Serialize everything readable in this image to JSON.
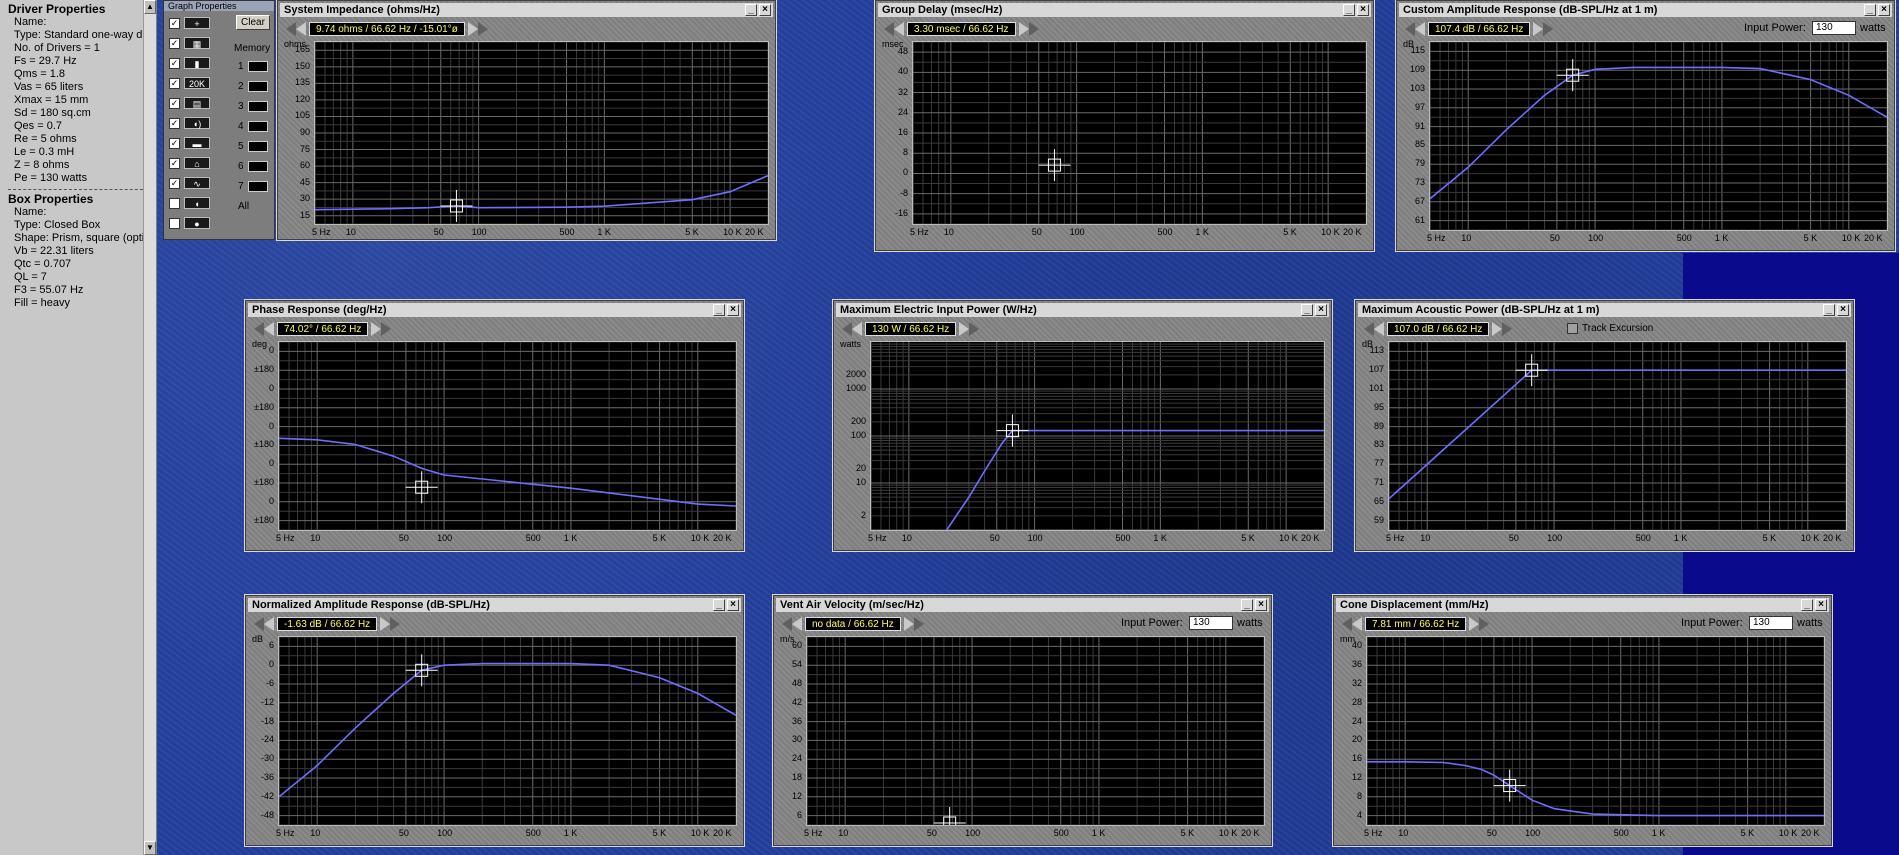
{
  "driver_properties": {
    "heading": "Driver Properties",
    "rows": [
      "Name:",
      "Type: Standard one-way driv",
      "No. of Drivers = 1",
      "Fs = 29.7 Hz",
      "Qms = 1.8",
      "Vas = 65 liters",
      "Xmax = 15 mm",
      "Sd = 180 sq.cm",
      "Qes = 0.7",
      "Re = 5 ohms",
      "Le = 0.3 mH",
      "Z = 8 ohms",
      "Pe = 130 watts"
    ]
  },
  "box_properties": {
    "heading": "Box Properties",
    "rows": [
      "Name:",
      "Type: Closed Box",
      "Shape: Prism, square (optimu",
      "Vb = 22.31 liters",
      "Qtc = 0.707",
      "QL = 7",
      "F3 = 55.07 Hz",
      "Fill = heavy"
    ]
  },
  "graph_properties": {
    "title": "Graph Properties",
    "clear_label": "Clear",
    "memory_label": "Memory",
    "memory_slots": [
      "1",
      "2",
      "3",
      "4",
      "5",
      "6",
      "7"
    ],
    "all_label": "All",
    "icons": [
      "crosshair-icon",
      "grid-icon",
      "marker-icon",
      "range-20k-icon",
      "print-icon",
      "speaker-sound-icon",
      "speaker-box-icon",
      "house-icon",
      "waveform-icon",
      "speaker-small-icon",
      "record-icon"
    ]
  },
  "x_ticks": [
    "5 Hz",
    "10",
    "50",
    "100",
    "500",
    "1 K",
    "5 K",
    "10 K",
    "20 K"
  ],
  "input_power_label": "Input Power:",
  "input_power_value": "130",
  "input_power_unit": "watts",
  "track_excursion_label": "Track Excursion",
  "colors": {
    "curve": "#6f6fff",
    "readout_text": "#ffff66",
    "background": "#223f9e",
    "plot_bg": "#000000"
  },
  "graphs": [
    {
      "id": "impedance",
      "title": "System Impedance (ohms/Hz)",
      "readout": "9.74 ohms / 66.62 Hz / -15.01°ø",
      "yunit": "ohms",
      "yticks": [
        "165",
        "150",
        "135",
        "120",
        "105",
        "90",
        "75",
        "60",
        "45",
        "30",
        "15"
      ],
      "chart_data": {
        "type": "line",
        "xlabel": "",
        "ylabel": "ohms",
        "xscale": "log",
        "xlim": [
          5,
          20000
        ],
        "ylim": [
          0,
          165
        ],
        "cursor": [
          66.62,
          9.74
        ],
        "x": [
          5,
          20,
          40,
          66.62,
          100,
          500,
          1000,
          5000,
          10000,
          20000
        ],
        "y": [
          6,
          7,
          8,
          9.74,
          8,
          8.5,
          9.5,
          16,
          24,
          40
        ]
      }
    },
    {
      "id": "group-delay",
      "title": "Group Delay (msec/Hz)",
      "readout": "3.30 msec / 66.62 Hz",
      "yunit": "msec",
      "yticks": [
        "48",
        "40",
        "32",
        "24",
        "16",
        "8",
        "0",
        "-8",
        "-16"
      ],
      "chart_data": {
        "type": "line",
        "xlabel": "",
        "ylabel": "msec",
        "xscale": "log",
        "xlim": [
          5,
          20000
        ],
        "ylim": [
          -16,
          48
        ],
        "cursor": [
          66.62,
          3.3
        ],
        "x": [],
        "y": []
      }
    },
    {
      "id": "custom-amplitude",
      "title": "Custom Amplitude Response (dB-SPL/Hz at 1 m)",
      "readout": "107.4 dB / 66.62 Hz",
      "yunit": "dB",
      "yticks": [
        "115",
        "109",
        "103",
        "97",
        "91",
        "85",
        "79",
        "73",
        "67",
        "61"
      ],
      "chart_data": {
        "type": "line",
        "xlabel": "",
        "ylabel": "dB",
        "xscale": "log",
        "xlim": [
          5,
          20000
        ],
        "ylim": [
          61,
          115
        ],
        "cursor": [
          66.62,
          107.4
        ],
        "x": [
          5,
          10,
          20,
          40,
          66.62,
          100,
          200,
          1000,
          2000,
          5000,
          10000,
          20000
        ],
        "y": [
          68,
          78,
          90,
          101,
          107.4,
          109.3,
          109.9,
          109.9,
          109.5,
          106,
          101,
          94
        ]
      }
    },
    {
      "id": "phase",
      "title": "Phase Response (deg/Hz)",
      "readout": "74.02° / 66.62 Hz",
      "yunit": "deg",
      "yticks": [
        "0",
        "±180",
        "0",
        "±180",
        "0",
        "±180",
        "0",
        "±180",
        "0",
        "±180"
      ],
      "chart_data": {
        "type": "line",
        "xlabel": "",
        "ylabel": "deg",
        "xscale": "log",
        "xlim": [
          5,
          20000
        ],
        "cursor": [
          66.62,
          74.02
        ],
        "x": [
          5,
          10,
          20,
          40,
          66.62,
          100,
          1000,
          10000,
          20000
        ],
        "y": [
          178,
          175,
          165,
          140,
          114,
          100,
          72,
          38,
          34
        ]
      }
    },
    {
      "id": "max-electric-power",
      "title": "Maximum Electric Input Power (W/Hz)",
      "readout": "130 W / 66.62 Hz",
      "yunit": "watts",
      "yticks": [
        "2000",
        "1000",
        "200",
        "100",
        "20",
        "10",
        "2"
      ],
      "chart_data": {
        "type": "line",
        "xlabel": "",
        "ylabel": "watts",
        "xscale": "log",
        "yscale": "log",
        "xlim": [
          5,
          20000
        ],
        "ylim": [
          1,
          10000
        ],
        "cursor": [
          66.62,
          130
        ],
        "x": [
          20,
          30,
          40,
          55,
          66.62,
          20000
        ],
        "y": [
          1,
          5,
          18,
          70,
          130,
          130
        ]
      }
    },
    {
      "id": "max-acoustic-power",
      "title": "Maximum Acoustic Power (dB-SPL/Hz at 1 m)",
      "readout": "107.0 dB / 66.62 Hz",
      "yunit": "dB",
      "yticks": [
        "113",
        "107",
        "101",
        "95",
        "89",
        "83",
        "77",
        "71",
        "65",
        "59"
      ],
      "chart_data": {
        "type": "line",
        "xlabel": "",
        "ylabel": "dB",
        "xscale": "log",
        "xlim": [
          5,
          20000
        ],
        "ylim": [
          59,
          113
        ],
        "cursor": [
          66.62,
          107.0
        ],
        "x": [
          5,
          66.62,
          20000
        ],
        "y": [
          66,
          107,
          107
        ]
      }
    },
    {
      "id": "normalized-amplitude",
      "title": "Normalized Amplitude Response (dB-SPL/Hz)",
      "readout": "-1.63 dB / 66.62 Hz",
      "yunit": "dB",
      "yticks": [
        "6",
        "0",
        "-6",
        "-12",
        "-18",
        "-24",
        "-30",
        "-36",
        "-42",
        "-48"
      ],
      "chart_data": {
        "type": "line",
        "xlabel": "",
        "ylabel": "dB",
        "xscale": "log",
        "xlim": [
          5,
          20000
        ],
        "ylim": [
          -48,
          6
        ],
        "cursor": [
          66.62,
          -1.63
        ],
        "x": [
          5,
          10,
          20,
          40,
          66.62,
          100,
          200,
          1000,
          2000,
          5000,
          10000,
          20000
        ],
        "y": [
          -42,
          -32,
          -20,
          -9,
          -1.63,
          0,
          0.5,
          0.5,
          0,
          -4,
          -9,
          -16
        ]
      }
    },
    {
      "id": "vent-air-velocity",
      "title": "Vent Air Velocity (m/sec/Hz)",
      "readout": "no data / 66.62 Hz",
      "yunit": "m/s",
      "yticks": [
        "60",
        "54",
        "48",
        "42",
        "36",
        "30",
        "24",
        "18",
        "12",
        "6"
      ],
      "chart_data": {
        "type": "line",
        "xlabel": "",
        "ylabel": "m/s",
        "xscale": "log",
        "xlim": [
          5,
          20000
        ],
        "ylim": [
          0,
          60
        ],
        "cursor": [
          66.62,
          0
        ],
        "x": [],
        "y": []
      }
    },
    {
      "id": "cone-displacement",
      "title": "Cone Displacement (mm/Hz)",
      "readout": "7.81 mm / 66.62 Hz",
      "yunit": "mm",
      "yticks": [
        "40",
        "36",
        "32",
        "28",
        "24",
        "20",
        "16",
        "12",
        "8",
        "4"
      ],
      "chart_data": {
        "type": "line",
        "xlabel": "",
        "ylabel": "mm",
        "xscale": "log",
        "xlim": [
          5,
          20000
        ],
        "ylim": [
          0,
          44
        ],
        "cursor": [
          66.62,
          7.81
        ],
        "x": [
          5,
          10,
          20,
          30,
          40,
          50,
          66.62,
          100,
          150,
          300,
          1000,
          20000
        ],
        "y": [
          14,
          14,
          13.8,
          13,
          12,
          10.5,
          7.81,
          4,
          1.8,
          0.4,
          0,
          0
        ]
      }
    }
  ]
}
